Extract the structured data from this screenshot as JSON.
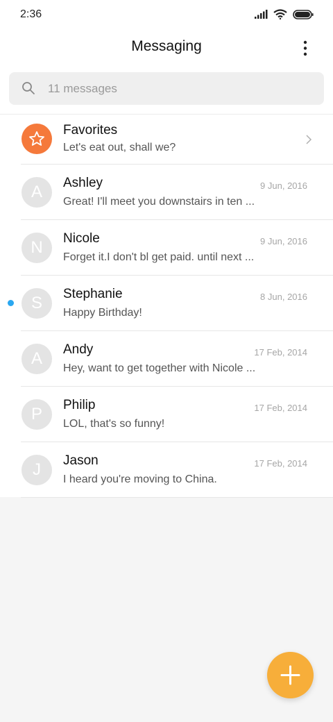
{
  "status_bar": {
    "time": "2:36"
  },
  "header": {
    "title": "Messaging"
  },
  "search": {
    "placeholder": "11 messages"
  },
  "favorites": {
    "name": "Favorites",
    "preview": "Let's eat out, shall we?"
  },
  "conversations": [
    {
      "initial": "A",
      "name": "Ashley",
      "date": "9 Jun, 2016",
      "preview": "Great! I'll meet you downstairs in ten ..."
    },
    {
      "initial": "N",
      "name": "Nicole",
      "date": "9 Jun, 2016",
      "preview": "Forget it.I don't bl get paid. until next ..."
    },
    {
      "initial": "S",
      "name": "Stephanie",
      "date": "8 Jun, 2016",
      "preview": "Happy Birthday!",
      "unread": true
    },
    {
      "initial": "A",
      "name": "Andy",
      "date": "17 Feb, 2014",
      "preview": "Hey, want to get together with Nicole ..."
    },
    {
      "initial": "P",
      "name": "Philip",
      "date": "17 Feb, 2014",
      "preview": "LOL, that's so funny!"
    },
    {
      "initial": "J",
      "name": "Jason",
      "date": "17 Feb, 2014",
      "preview": "I heard you're moving to China."
    }
  ],
  "icons": {
    "more": "more-vertical-icon",
    "search": "search-icon",
    "favorite": "star-icon",
    "chevron": "chevron-right-icon",
    "fab": "plus-icon"
  },
  "colors": {
    "favorite_avatar": "#f5793b",
    "unread_dot": "#2aa7f0",
    "fab": "#f7ae3a"
  }
}
